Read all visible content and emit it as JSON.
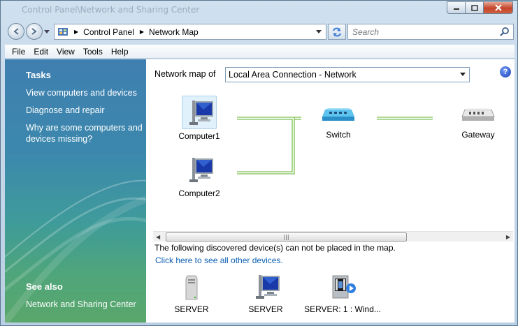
{
  "window": {
    "title": "Control Panel\\Network and Sharing Center",
    "close_icon": "close-icon",
    "maximize_icon": "maximize-icon",
    "minimize_icon": "minimize-icon"
  },
  "address": {
    "crumbs": [
      "Control Panel",
      "Network Map"
    ],
    "search_placeholder": "Search"
  },
  "menu": [
    "File",
    "Edit",
    "View",
    "Tools",
    "Help"
  ],
  "tasks": {
    "heading": "Tasks",
    "links": [
      "View computers and devices",
      "Diagnose and repair",
      "Why are some computers and devices missing?"
    ],
    "see_also_heading": "See also",
    "see_also_links": [
      "Network and Sharing Center"
    ]
  },
  "map": {
    "label": "Network map of",
    "selected_network": "Local Area Connection - Network",
    "nodes": {
      "computer1": "Computer1",
      "computer2": "Computer2",
      "switch": "Switch",
      "gateway": "Gateway"
    },
    "undiscovered_text": "The following discovered device(s) can not be placed in the map.",
    "see_all_link": "Click here to see all other devices.",
    "devices": [
      "SERVER",
      "SERVER",
      "SERVER: 1 : Wind..."
    ]
  },
  "colors": {
    "connection_line": "#7cbf52",
    "link_blue": "#0b5fb5"
  }
}
